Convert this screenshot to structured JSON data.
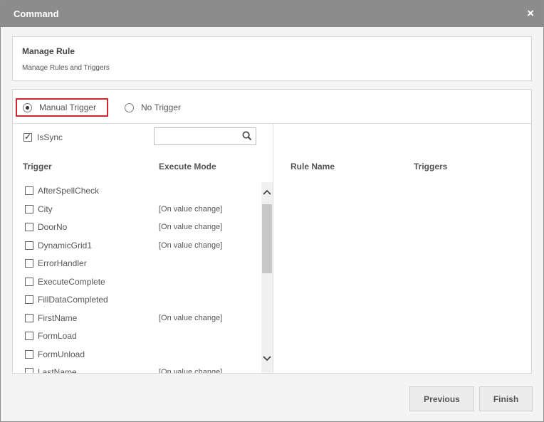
{
  "dialog": {
    "title": "Command",
    "close_symbol": "×"
  },
  "manage": {
    "title": "Manage Rule",
    "subtitle": "Manage Rules and Triggers"
  },
  "trigger_options": [
    {
      "label": "Manual Trigger",
      "selected": true
    },
    {
      "label": "No Trigger",
      "selected": false
    }
  ],
  "issync": {
    "label": "IsSync",
    "checked": true
  },
  "search": {
    "value": "",
    "placeholder": ""
  },
  "columns": {
    "trigger": "Trigger",
    "execute_mode": "Execute Mode",
    "rule_name": "Rule Name",
    "triggers": "Triggers"
  },
  "items": [
    {
      "name": "AfterSpellCheck",
      "mode": ""
    },
    {
      "name": "City",
      "mode": "[On value change]"
    },
    {
      "name": "DoorNo",
      "mode": "[On value change]"
    },
    {
      "name": "DynamicGrid1",
      "mode": "[On value change]"
    },
    {
      "name": "ErrorHandler",
      "mode": ""
    },
    {
      "name": "ExecuteComplete",
      "mode": ""
    },
    {
      "name": "FillDataCompleted",
      "mode": ""
    },
    {
      "name": "FirstName",
      "mode": "[On value change]"
    },
    {
      "name": "FormLoad",
      "mode": ""
    },
    {
      "name": "FormUnload",
      "mode": ""
    },
    {
      "name": "LastName",
      "mode": "[On value change]"
    }
  ],
  "buttons": {
    "previous": "Previous",
    "finish": "Finish"
  },
  "colors": {
    "titlebar": "#8c8c8c",
    "highlight_border": "#d0272d",
    "button_bg": "#ececec"
  },
  "icons": {
    "search": "search-icon",
    "close": "close-icon",
    "scroll_up": "chevron-up-icon",
    "scroll_down": "chevron-down-icon"
  }
}
